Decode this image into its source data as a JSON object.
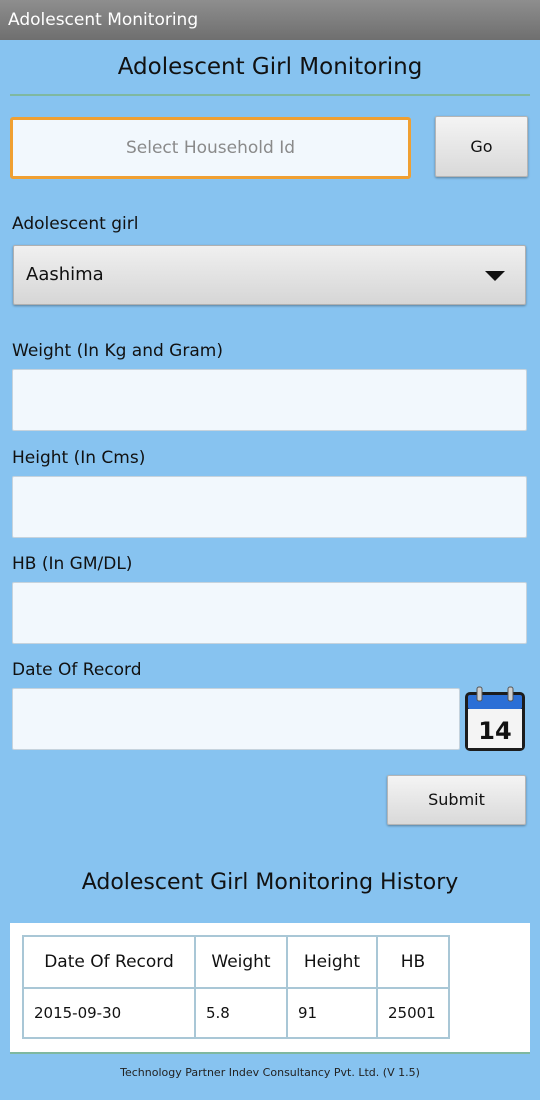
{
  "app": {
    "title": "Adolescent Monitoring"
  },
  "header": {
    "title": "Adolescent Girl Monitoring"
  },
  "household": {
    "placeholder": "Select Household Id",
    "go_label": "Go"
  },
  "form": {
    "girl_label": "Adolescent girl",
    "girl_selected": "Aashima",
    "weight_label": "Weight (In Kg and Gram)",
    "weight_value": "",
    "height_label": "Height (In Cms)",
    "height_value": "",
    "hb_label": "HB (In GM/DL)",
    "hb_value": "",
    "date_label": "Date Of Record",
    "date_value": "",
    "calendar_icon": "calendar-icon",
    "calendar_day": "14",
    "submit_label": "Submit"
  },
  "history": {
    "title": "Adolescent Girl Monitoring History",
    "columns": [
      "Date Of Record",
      "Weight",
      "Height",
      "HB"
    ],
    "rows": [
      [
        "2015-09-30",
        "5.8",
        "91",
        "25001"
      ]
    ]
  },
  "footer": {
    "text": "Technology Partner Indev Consultancy Pvt. Ltd. (V 1.5)"
  },
  "colors": {
    "background": "#87c3f0",
    "accent_focus": "#f0a032",
    "divider": "#7fb8a0",
    "calendar_blue": "#2b6fd6"
  }
}
